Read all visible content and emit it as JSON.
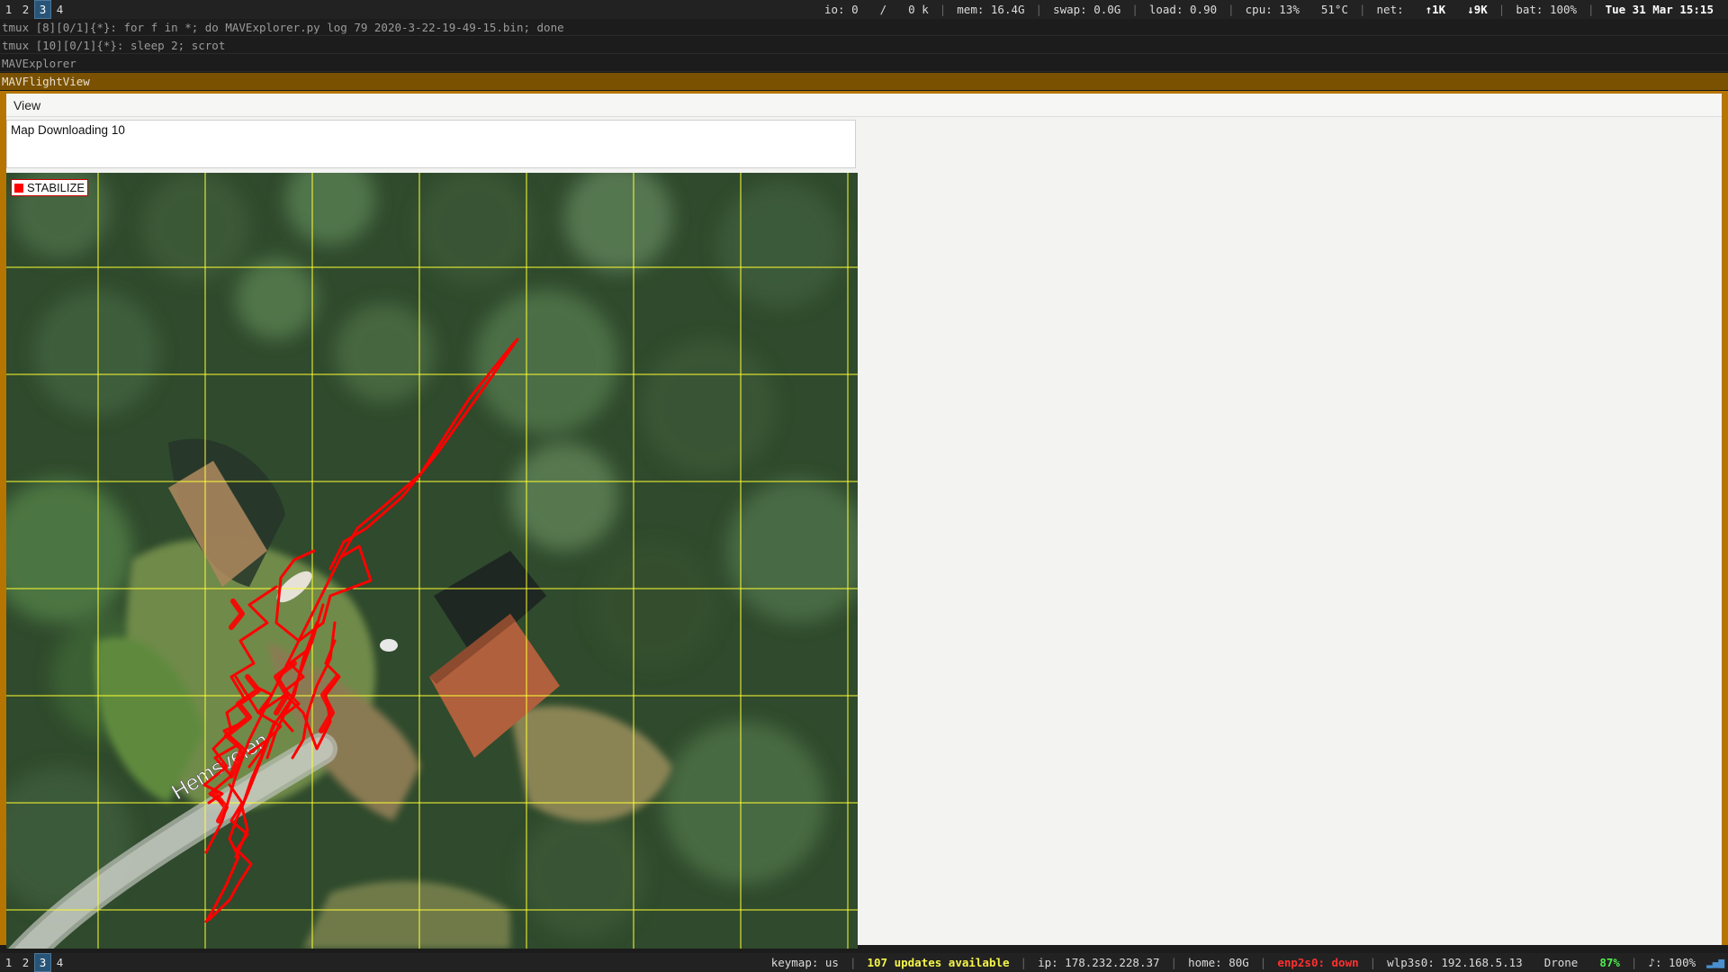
{
  "top_bar": {
    "workspaces": [
      "1",
      "2",
      "3",
      "4"
    ],
    "active_workspace": "3",
    "io": "io: 0",
    "io_sep": "/",
    "io_k": "0 k",
    "mem": "mem: 16.4G",
    "swap": "swap: 0.0G",
    "load": "load: 0.90",
    "cpu": "cpu:  13%",
    "temp": "51°C",
    "net_label": "net:",
    "net_up": "↑1K",
    "net_down": "↓9K",
    "bat": "bat: 100%",
    "clock": "Tue 31 Mar 15:15"
  },
  "terminal_lines": {
    "line1": "tmux [8][0/1]{*}:  for f in *; do MAVExplorer.py log 79 2020-3-22-19-49-15.bin; done",
    "line2": "tmux [10][0/1]{*}:  sleep 2; scrot",
    "line3": "MAVExplorer",
    "line4": "MAVFlightView"
  },
  "window": {
    "menu": [
      "View"
    ],
    "info_text": "Map Downloading 10",
    "mode_badge": "STABILIZE",
    "road_label": "Hemsveien",
    "colors": {
      "track": "#ff0000",
      "grid": "#ffff33",
      "frame": "#b57500"
    }
  },
  "bottom_bar": {
    "workspaces": [
      "1",
      "2",
      "3",
      "4"
    ],
    "active_workspace": "3",
    "keymap": "keymap: us",
    "updates": "107 updates available",
    "ip": "ip: 178.232.228.37",
    "home": "home: 80G",
    "enp": "enp2s0: down",
    "wlp": "wlp3s0: 192.168.5.13",
    "wifi_name": "Drone",
    "wifi_pct": "87%",
    "volume": "♪: 100%"
  }
}
